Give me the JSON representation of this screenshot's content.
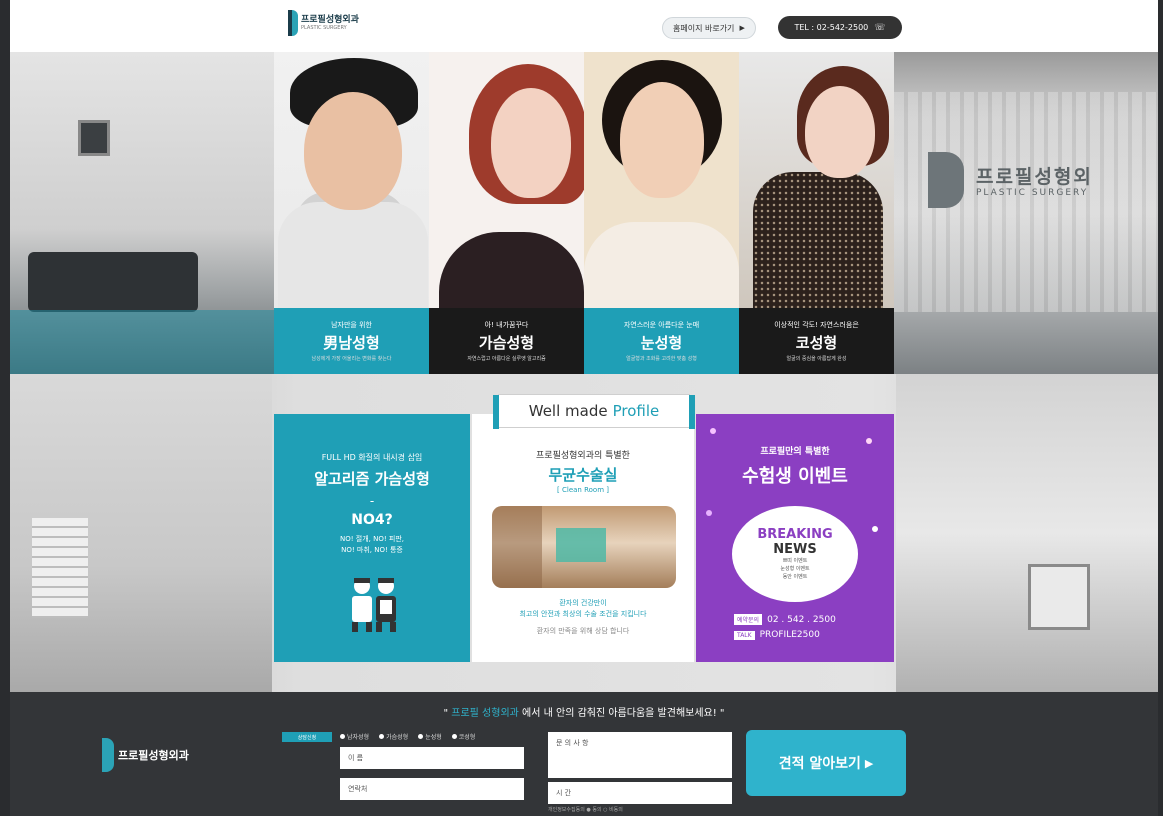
{
  "header": {
    "logo_text": "프로필성형외과",
    "logo_sub": "PLASTIC SURGERY",
    "homepage_button": "홈페이지 바로가기",
    "tel_button": "TEL : 02-542-2500"
  },
  "hero": {
    "wall_sign_text": "프로필성형외",
    "wall_sign_sub": "PLASTIC SURGERY",
    "cards": [
      {
        "kicker": "남자만을 위한",
        "title": "男남성형",
        "desc": "남성에게 가장 어울리는 변화를 찾는다"
      },
      {
        "kicker": "아! 내가꿈꾸다",
        "title": "가슴성형",
        "desc": "자연스럽고 아름다운 실루엣 알고리즘"
      },
      {
        "kicker": "자연스러운 아름다운 눈매",
        "title": "눈성형",
        "desc": "얼굴형과 조화를 고려한 맞춤 성형"
      },
      {
        "kicker": "이상적인 각도! 자연스러움은",
        "title": "코성형",
        "desc": "얼굴의 중심을 아름답게 완성"
      }
    ]
  },
  "middle": {
    "badge_text_1": "Well made",
    "badge_text_2": "Profile",
    "teal_panel": {
      "line1": "FULL HD 화질의 내시경 삽입",
      "line2": "알고리즘 가슴성형",
      "dash": "-",
      "line3": "NO4?",
      "line4a": "NO! 절개, NO! 피판,",
      "line4b": "NO! 마취, NO! 통증"
    },
    "white_panel": {
      "line1": "프로필성형외과의 특별한",
      "line2": "무균수술실",
      "line3": "[ Clean Room ]",
      "line4a": "환자의 건강만이",
      "line4b": "최고의 안전과 최상의 수술 조건을 지킵니다",
      "line5": "환자의 만족을 위해 상담 합니다"
    },
    "purple_panel": {
      "line1": "프로필만의 특별한",
      "line2": "수험생 이벤트",
      "news1": "BREAKING",
      "news2": "NEWS",
      "news3a": "쁘띠 이벤트",
      "news3b": "눈성형 이벤트",
      "news3c": "동안 이벤트",
      "phone_tag": "예약문의",
      "phone_val": "02 . 542 . 2500",
      "talk_tag": "TALK",
      "talk_val": "PROFILE2500"
    }
  },
  "bottom": {
    "slogan_pre": "\"",
    "slogan_hl": "프로필 성형외과",
    "slogan_post": "에서 내 안의 감춰진 아름다움을 발견해보세요! \"",
    "logo_text": "프로필성형외과",
    "form_tag": "상담신청",
    "options": [
      "남자성형",
      "가슴성형",
      "눈성형",
      "코성형"
    ],
    "name_label": "이 름",
    "phone_label": "연락처",
    "memo_label": "문 의 사 항",
    "time_label": "시 간",
    "agree_text": "개인정보수집동의  ● 동의  ○ 비동의",
    "submit_label": "견적 알아보기"
  },
  "colors": {
    "teal": "#1f9fb6",
    "purple": "#8b3fc2",
    "dark": "#333538"
  }
}
